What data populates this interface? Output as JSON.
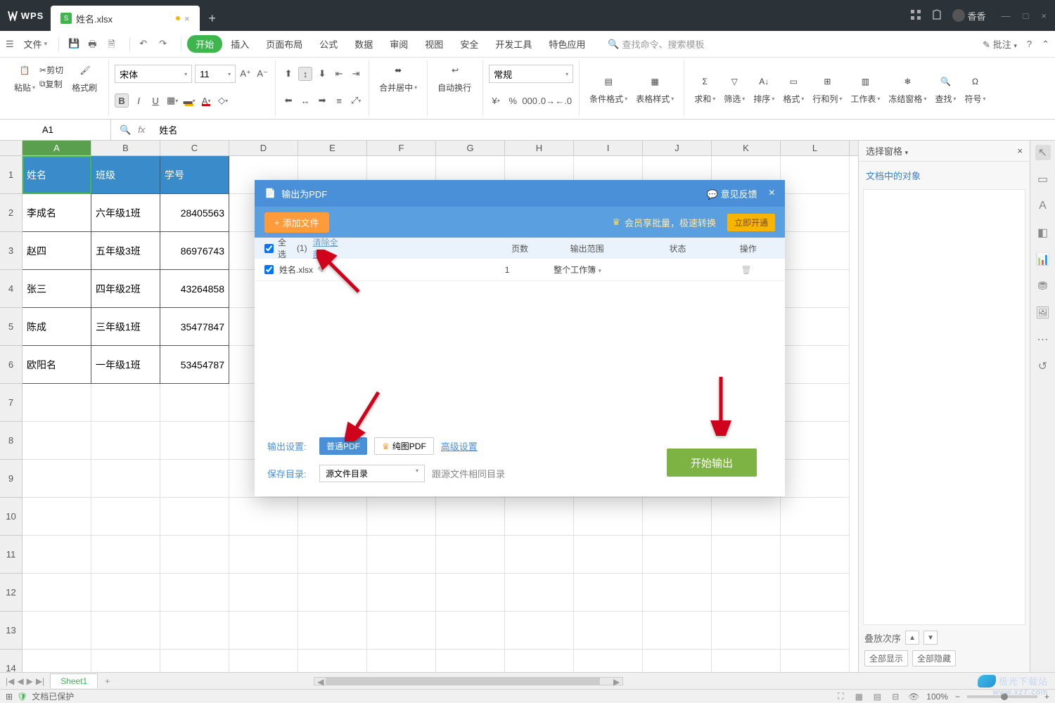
{
  "titlebar": {
    "app": "WPS",
    "tab_name": "姓名.xlsx",
    "user_name": "香香"
  },
  "menubar": {
    "file": "文件",
    "items": [
      "开始",
      "插入",
      "页面布局",
      "公式",
      "数据",
      "审阅",
      "视图",
      "安全",
      "开发工具",
      "特色应用"
    ],
    "search_placeholder": "查找命令、搜索模板",
    "annotate": "批注"
  },
  "ribbon": {
    "clipboard": {
      "paste": "粘贴",
      "cut": "剪切",
      "copy": "复制",
      "format_painter": "格式刷"
    },
    "font": {
      "name": "宋体",
      "size": "11"
    },
    "align": {
      "merge": "合并居中",
      "wrap": "自动换行"
    },
    "number": {
      "format": "常规"
    },
    "styles": {
      "cond": "条件格式",
      "table": "表格样式"
    },
    "cells": {
      "sum": "求和",
      "filter": "筛选",
      "sort": "排序",
      "fmt": "格式",
      "rowcol": "行和列",
      "sheet": "工作表",
      "freeze": "冻结窗格",
      "find": "查找",
      "symbol": "符号"
    }
  },
  "formula": {
    "cell_ref": "A1",
    "content": "姓名"
  },
  "columns": [
    "A",
    "B",
    "C",
    "D",
    "E",
    "F",
    "G",
    "H",
    "I",
    "J",
    "K",
    "L"
  ],
  "table": {
    "headers": [
      "姓名",
      "班级",
      "学号"
    ],
    "rows": [
      [
        "李成名",
        "六年级1班",
        "28405563"
      ],
      [
        "赵四",
        "五年级3班",
        "86976743"
      ],
      [
        "张三",
        "四年级2班",
        "43264858"
      ],
      [
        "陈成",
        "三年级1班",
        "35477847"
      ],
      [
        "欧阳名",
        "一年级1班",
        "53454787"
      ]
    ]
  },
  "sidepanel": {
    "title": "选择窗格",
    "subtitle": "文档中的对象",
    "stack_label": "叠放次序",
    "show_all": "全部显示",
    "hide_all": "全部隐藏"
  },
  "sheettabs": {
    "name": "Sheet1"
  },
  "statusbar": {
    "protected": "文档已保护",
    "zoom": "100%"
  },
  "dialog": {
    "title": "输出为PDF",
    "feedback": "意见反馈",
    "add_file": "添加文件",
    "vip_text": "会员享批量，极速转换",
    "open_now": "立即开通",
    "select_all": "全选",
    "count": "(1)",
    "clear_all": "清除全部",
    "col_pages": "页数",
    "col_range": "输出范围",
    "col_status": "状态",
    "col_action": "操作",
    "file_name": "姓名.xlsx",
    "file_pages": "1",
    "file_range": "整个工作簿",
    "out_label": "输出设置:",
    "pdf_normal": "普通PDF",
    "pdf_pure": "纯图PDF",
    "advanced": "高级设置",
    "save_label": "保存目录:",
    "save_dir": "源文件目录",
    "save_hint": "跟源文件相同目录",
    "start": "开始输出"
  },
  "watermark": "极光下载站",
  "watermark_url": "www.xz7.com"
}
